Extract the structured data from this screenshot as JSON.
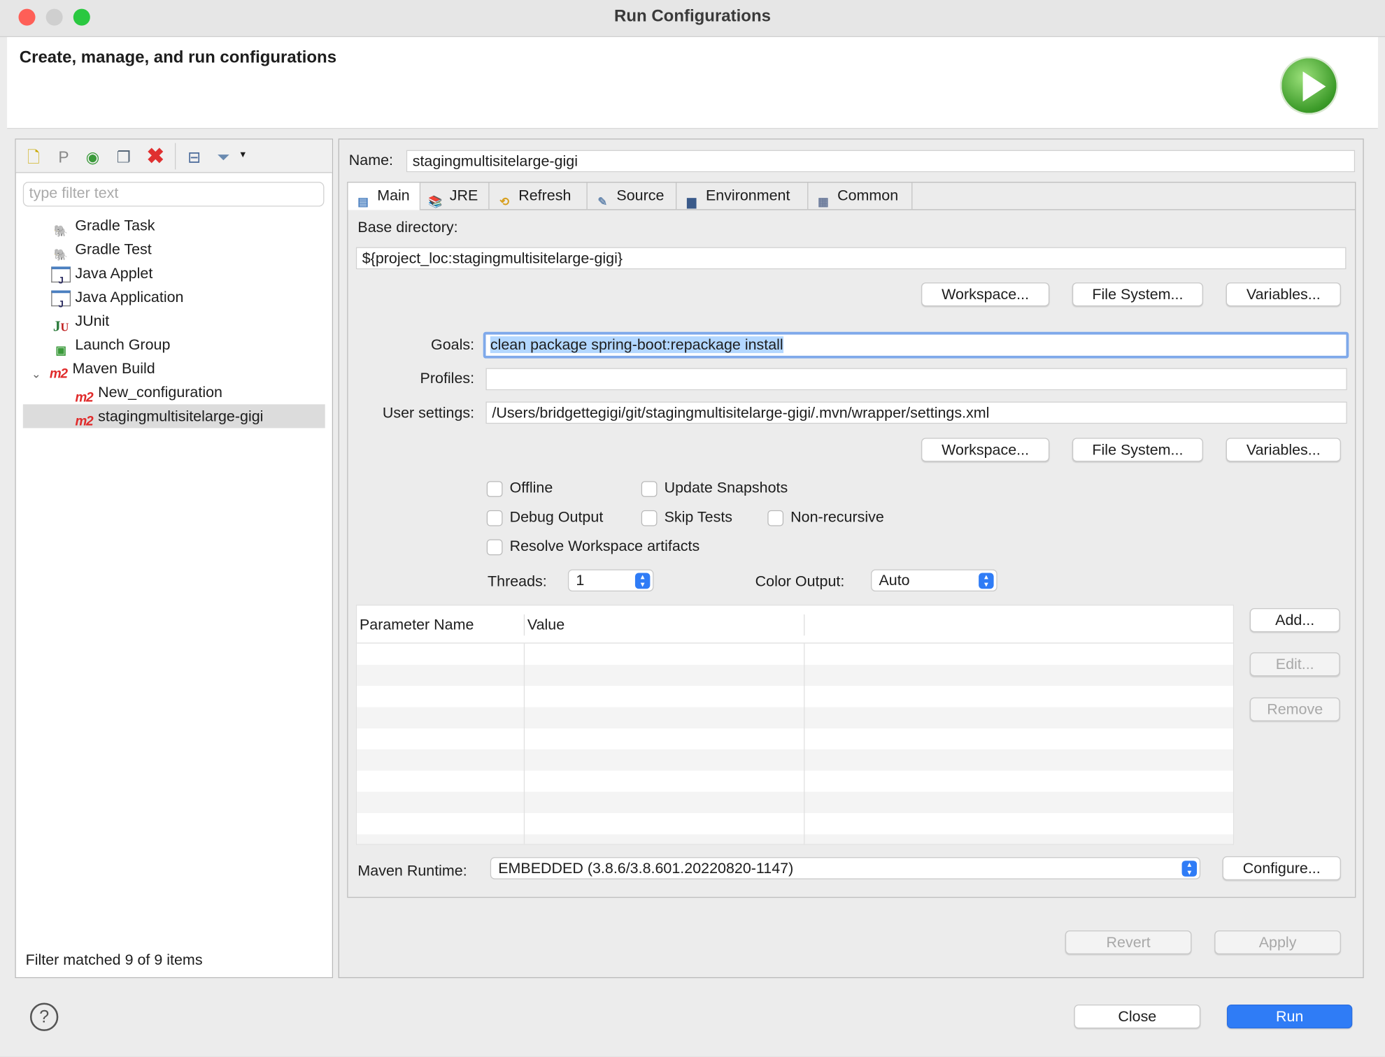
{
  "window": {
    "title": "Run Configurations",
    "header": "Create, manage, and run configurations"
  },
  "left": {
    "filter_placeholder": "type filter text",
    "items": [
      {
        "label": "Gradle Task",
        "icon": "gradle-elephant-dark-icon"
      },
      {
        "label": "Gradle Test",
        "icon": "gradle-elephant-light-icon"
      },
      {
        "label": "Java Applet",
        "icon": "java-applet-icon"
      },
      {
        "label": "Java Application",
        "icon": "java-application-icon"
      },
      {
        "label": "JUnit",
        "icon": "junit-icon"
      },
      {
        "label": "Launch Group",
        "icon": "launch-group-icon"
      },
      {
        "label": "Maven Build",
        "icon": "m2-icon",
        "expanded": true
      },
      {
        "label": "New_configuration",
        "icon": "m2-icon"
      },
      {
        "label": "stagingmultisitelarge-gigi",
        "icon": "m2-icon",
        "selected": true
      }
    ],
    "status": "Filter matched 9 of 9 items"
  },
  "right": {
    "name_label": "Name:",
    "name_value": "stagingmultisitelarge-gigi",
    "tabs": [
      "Main",
      "JRE",
      "Refresh",
      "Source",
      "Environment",
      "Common"
    ],
    "active_tab": "Main",
    "base_dir_label": "Base directory:",
    "base_dir_value": "${project_loc:stagingmultisitelarge-gigi}",
    "workspace": "Workspace...",
    "file_system": "File System...",
    "variables": "Variables...",
    "goals_label": "Goals:",
    "goals_value": "clean package spring-boot:repackage install",
    "profiles_label": "Profiles:",
    "profiles_value": "",
    "user_settings_label": "User settings:",
    "user_settings_value": "/Users/bridgettegigi/git/stagingmultisitelarge-gigi/.mvn/wrapper/settings.xml",
    "checkboxes": {
      "offline": "Offline",
      "update_snapshots": "Update Snapshots",
      "debug_output": "Debug Output",
      "skip_tests": "Skip Tests",
      "non_recursive": "Non-recursive",
      "resolve_workspace": "Resolve Workspace artifacts"
    },
    "threads_label": "Threads:",
    "threads_value": "1",
    "color_output_label": "Color Output:",
    "color_output_value": "Auto",
    "table": {
      "headers": [
        "Parameter Name",
        "Value"
      ],
      "rows": []
    },
    "add": "Add...",
    "edit": "Edit...",
    "remove": "Remove",
    "maven_runtime_label": "Maven Runtime:",
    "maven_runtime_value": "EMBEDDED (3.8.6/3.8.601.20220820-1147)",
    "configure": "Configure...",
    "revert": "Revert",
    "apply": "Apply"
  },
  "footer": {
    "close": "Close",
    "run": "Run"
  },
  "colors": {
    "accent": "#2f7cf6",
    "selection": "#b3d7ff"
  }
}
